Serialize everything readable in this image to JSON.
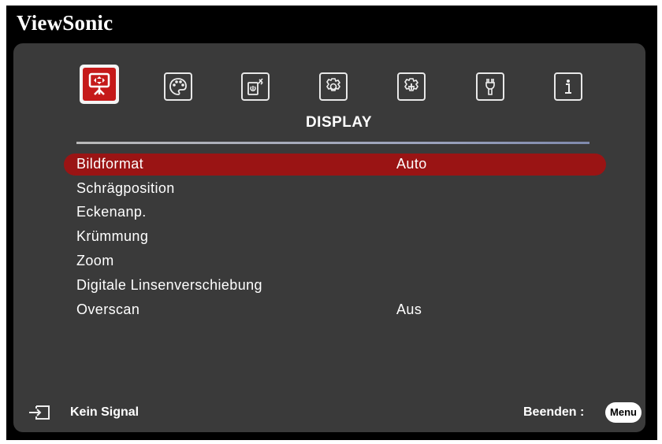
{
  "brand": "ViewSonic",
  "tabs": [
    {
      "icon": "display-icon",
      "active": true
    },
    {
      "icon": "palette-icon",
      "active": false
    },
    {
      "icon": "power-icon",
      "active": false
    },
    {
      "icon": "settings-gear-icon",
      "active": false
    },
    {
      "icon": "advanced-gear-icon",
      "active": false
    },
    {
      "icon": "wrench-icon",
      "active": false
    },
    {
      "icon": "info-icon",
      "active": false
    }
  ],
  "section_title": "DISPLAY",
  "menu": {
    "items": [
      {
        "label": "Bildformat",
        "value": "Auto",
        "selected": true
      },
      {
        "label": "Schrägposition",
        "value": ""
      },
      {
        "label": "Eckenanp.",
        "value": ""
      },
      {
        "label": "Krümmung",
        "value": ""
      },
      {
        "label": "Zoom",
        "value": ""
      },
      {
        "label": "Digitale Linsenverschiebung",
        "value": ""
      },
      {
        "label": "Overscan",
        "value": "Aus"
      }
    ]
  },
  "footer": {
    "input_icon": "input-source-icon",
    "status": "Kein Signal",
    "exit_label": "Beenden :",
    "menu_button": "Menu"
  },
  "colors": {
    "highlight": "#9a1414",
    "active_tab": "#c51a1a",
    "panel": "#3a3a3a",
    "frame": "#000000"
  }
}
